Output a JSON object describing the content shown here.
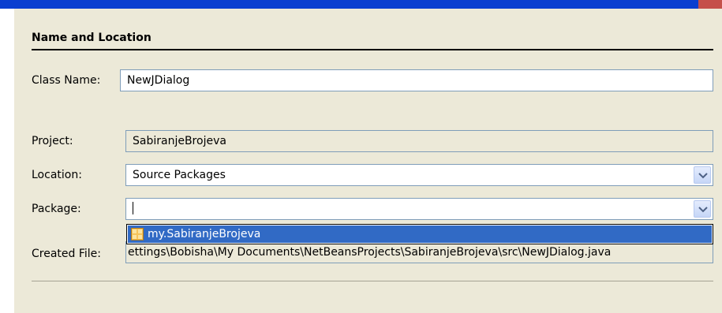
{
  "section": {
    "title": "Name and Location"
  },
  "class_name": {
    "label": "Class Name:",
    "value": "NewJDialog"
  },
  "project": {
    "label": "Project:",
    "value": "SabiranjeBrojeva"
  },
  "location": {
    "label": "Location:",
    "value": "Source Packages"
  },
  "package": {
    "label": "Package:",
    "value": "",
    "options": [
      "my.SabiranjeBrojeva"
    ]
  },
  "created_file": {
    "label": "Created File:",
    "value": "ettings\\Bobisha\\My Documents\\NetBeansProjects\\SabiranjeBrojeva\\src\\NewJDialog.java"
  },
  "icons": {
    "dropdown": "chevron-down-icon",
    "package": "package-icon"
  },
  "colors": {
    "titlebar": "#0a3fd0",
    "selection": "#316ac5",
    "panel": "#ece9d8",
    "field_border": "#7f9db9"
  }
}
